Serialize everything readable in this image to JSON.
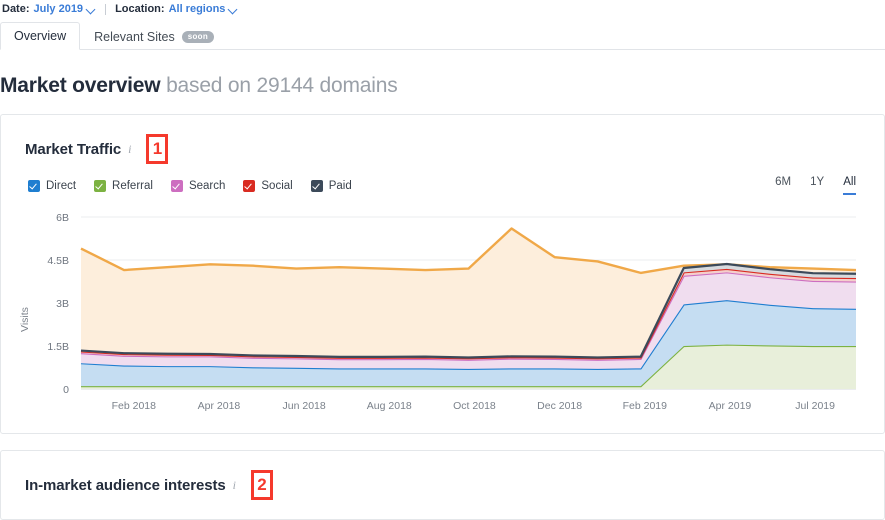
{
  "filterbar": {
    "date_label": "Date:",
    "date_value": "July 2019",
    "location_label": "Location:",
    "location_value": "All regions"
  },
  "tabs": [
    {
      "label": "Overview",
      "active": true,
      "badge": null
    },
    {
      "label": "Relevant Sites",
      "active": false,
      "badge": "soon"
    }
  ],
  "page_title": {
    "main": "Market overview",
    "sub": "based on 29144 domains"
  },
  "traffic_card": {
    "title": "Market Traffic",
    "info_icon": "info-icon",
    "annotation": "1",
    "legend": [
      {
        "label": "Direct",
        "color": "#1f7ed0"
      },
      {
        "label": "Referral",
        "color": "#7cb242"
      },
      {
        "label": "Search",
        "color": "#cd6ec0"
      },
      {
        "label": "Social",
        "color": "#d92b21"
      },
      {
        "label": "Paid",
        "color": "#3c4a5a"
      }
    ],
    "ranges": [
      {
        "label": "6M",
        "active": false
      },
      {
        "label": "1Y",
        "active": false
      },
      {
        "label": "All",
        "active": true
      }
    ]
  },
  "audience_card": {
    "title": "In-market audience interests",
    "info_icon": "info-icon",
    "annotation": "2"
  },
  "colors": {
    "accent_blue": "#3a7cd7",
    "annotation_red": "#f5392c",
    "text_dark": "#242d3c",
    "text_muted": "#9aa0a8",
    "border": "#e4e7ea"
  },
  "chart_data": {
    "type": "area",
    "stacked": true,
    "title": "Market Traffic",
    "xlabel": "",
    "ylabel": "Visits",
    "ylim": [
      0,
      6000000000
    ],
    "ytick_labels": [
      "0",
      "1.5B",
      "3B",
      "4.5B",
      "6B"
    ],
    "ytick_values": [
      0,
      1500000000,
      3000000000,
      4500000000,
      6000000000
    ],
    "grid": true,
    "legend_position": "top-left",
    "x": [
      "Jan 2018",
      "Feb 2018",
      "Mar 2018",
      "Apr 2018",
      "May 2018",
      "Jun 2018",
      "Jul 2018",
      "Aug 2018",
      "Sep 2018",
      "Oct 2018",
      "Nov 2018",
      "Dec 2018",
      "Jan 2019",
      "Feb 2019",
      "Mar 2019",
      "Apr 2019",
      "May 2019",
      "Jun 2019",
      "Jul 2019"
    ],
    "xtick_labels": [
      "Feb 2018",
      "Apr 2018",
      "Jun 2018",
      "Aug 2018",
      "Oct 2018",
      "Dec 2018",
      "Feb 2019",
      "Apr 2019",
      "Jul 2019"
    ],
    "series": [
      {
        "name": "Referral",
        "color": "#7cb242",
        "fill": "#e8efda",
        "values": [
          0.1,
          0.1,
          0.1,
          0.1,
          0.1,
          0.1,
          0.1,
          0.1,
          0.1,
          0.1,
          0.1,
          0.1,
          0.1,
          0.1,
          1.5,
          1.55,
          1.52,
          1.5,
          1.5
        ]
      },
      {
        "name": "Direct",
        "color": "#1f7ed0",
        "fill": "#c5ddf2",
        "values": [
          0.8,
          0.72,
          0.7,
          0.7,
          0.66,
          0.64,
          0.62,
          0.62,
          0.62,
          0.6,
          0.62,
          0.62,
          0.6,
          0.62,
          1.45,
          1.55,
          1.42,
          1.32,
          1.3
        ]
      },
      {
        "name": "Search",
        "color": "#cd6ec0",
        "fill": "#f0ddef",
        "values": [
          0.35,
          0.34,
          0.34,
          0.34,
          0.33,
          0.33,
          0.32,
          0.32,
          0.33,
          0.32,
          0.34,
          0.33,
          0.32,
          0.33,
          1.0,
          0.97,
          0.96,
          0.95,
          0.95
        ]
      },
      {
        "name": "Social",
        "color": "#d92b21",
        "fill": "#f4cfcc",
        "values": [
          0.06,
          0.06,
          0.06,
          0.05,
          0.05,
          0.05,
          0.05,
          0.05,
          0.05,
          0.05,
          0.05,
          0.05,
          0.05,
          0.05,
          0.12,
          0.12,
          0.12,
          0.12,
          0.12
        ]
      },
      {
        "name": "Paid",
        "color": "#3c4a5a",
        "fill": "#d7dade",
        "values": [
          0.03,
          0.03,
          0.03,
          0.03,
          0.03,
          0.03,
          0.03,
          0.03,
          0.03,
          0.03,
          0.03,
          0.03,
          0.03,
          0.03,
          0.15,
          0.17,
          0.16,
          0.15,
          0.15
        ]
      },
      {
        "name": "Total",
        "color": "#f0a848",
        "fill": "#fdeedc",
        "values": [
          4.9,
          4.15,
          4.25,
          4.35,
          4.3,
          4.2,
          4.25,
          4.2,
          4.15,
          4.2,
          5.6,
          4.6,
          4.45,
          4.05,
          4.3,
          4.35,
          4.25,
          4.2,
          4.15
        ]
      }
    ],
    "units": "billions of visits"
  }
}
